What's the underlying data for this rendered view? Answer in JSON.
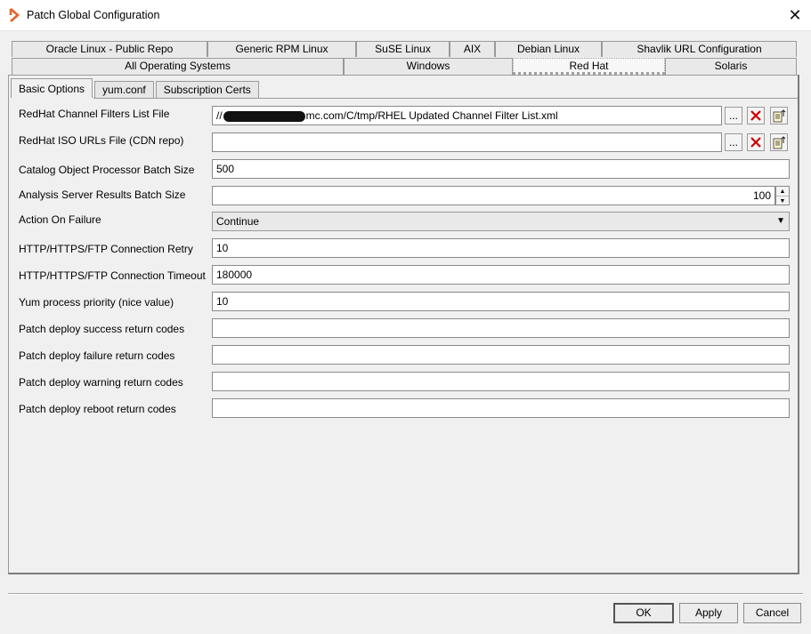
{
  "window": {
    "title": "Patch Global Configuration"
  },
  "tabs_row1": [
    "Oracle Linux - Public Repo",
    "Generic RPM Linux",
    "SuSE Linux",
    "AIX",
    "Debian Linux",
    "Shavlik URL Configuration"
  ],
  "tabs_row2": [
    "All Operating Systems",
    "Windows",
    "Red Hat",
    "Solaris"
  ],
  "selected_tab": "Red Hat",
  "subtabs": [
    "Basic Options",
    "yum.conf",
    "Subscription Certs"
  ],
  "fields": {
    "channel_filters": {
      "label": "RedHat Channel Filters List File",
      "value_prefix": "//",
      "value_suffix": "mc.com/C/tmp/RHEL Updated Channel Filter List.xml"
    },
    "iso_urls": {
      "label": "RedHat ISO URLs File (CDN repo)",
      "value": ""
    },
    "catalog_batch": {
      "label": "Catalog Object Processor Batch Size",
      "value": "500"
    },
    "analysis_batch": {
      "label": "Analysis Server Results Batch Size",
      "value": "100"
    },
    "action_on_failure": {
      "label": "Action On Failure",
      "value": "Continue"
    },
    "conn_retry": {
      "label": "HTTP/HTTPS/FTP Connection Retry",
      "value": "10"
    },
    "conn_timeout": {
      "label": "HTTP/HTTPS/FTP Connection Timeout",
      "value": "180000"
    },
    "yum_priority": {
      "label": "Yum process priority (nice value)",
      "value": "10"
    },
    "success_codes": {
      "label": "Patch deploy success return codes",
      "value": ""
    },
    "failure_codes": {
      "label": "Patch deploy failure return codes",
      "value": ""
    },
    "warning_codes": {
      "label": "Patch deploy warning return codes",
      "value": ""
    },
    "reboot_codes": {
      "label": "Patch deploy reboot return codes",
      "value": ""
    }
  },
  "buttons": {
    "browse": "...",
    "ok": "OK",
    "apply": "Apply",
    "cancel": "Cancel"
  },
  "icons": {
    "app": "bmc-logo-icon",
    "clear": "red-x-icon",
    "import": "import-file-icon"
  },
  "colors": {
    "brand": "#e8632b",
    "clear_red": "#cc0000"
  }
}
